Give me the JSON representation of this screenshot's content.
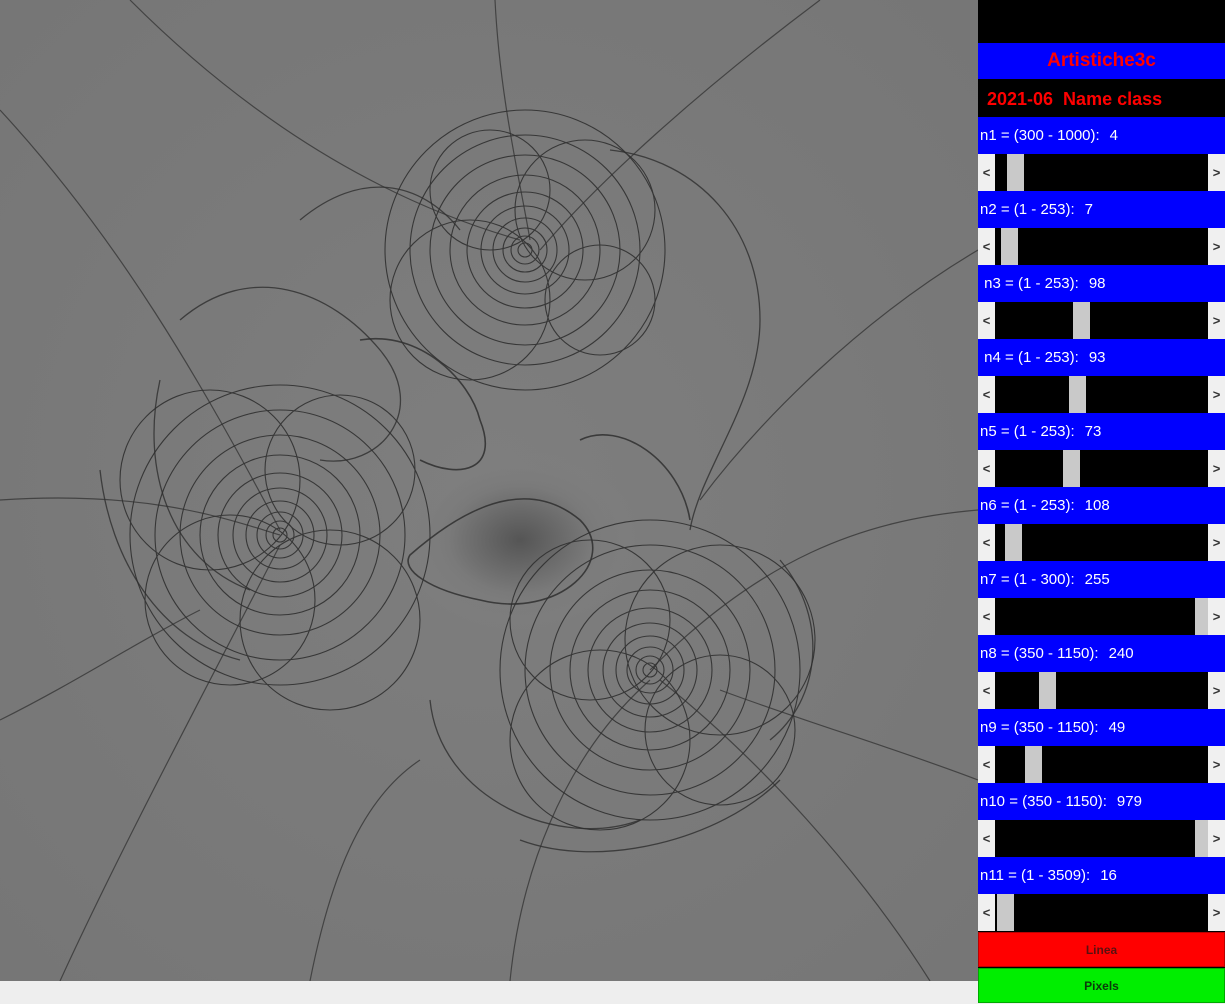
{
  "app": {
    "title": "Artistiche3c",
    "subtitle": "2021-06  Name class"
  },
  "params": [
    {
      "label": "n1 = (300 - 1000):",
      "value": "4",
      "slider_fraction": 0.06
    },
    {
      "label": "n2 = (1 - 253):",
      "value": "7",
      "slider_fraction": 0.03
    },
    {
      "label": " n3 = (1 - 253):",
      "value": "98",
      "slider_fraction": 0.39
    },
    {
      "label": " n4 = (1 - 253):",
      "value": "93",
      "slider_fraction": 0.37
    },
    {
      "label": "n5 = (1 - 253):",
      "value": "73",
      "slider_fraction": 0.34
    },
    {
      "label": "n6 = (1 - 253):",
      "value": "108",
      "slider_fraction": 0.05
    },
    {
      "label": "n7 = (1 - 300):",
      "value": "255",
      "slider_fraction": 1.0
    },
    {
      "label": "n8 = (350 - 1150):",
      "value": "240",
      "slider_fraction": 0.22
    },
    {
      "label": "n9 = (350 - 1150):",
      "value": "49",
      "slider_fraction": 0.15
    },
    {
      "label": "n10 = (350 - 1150):",
      "value": "979",
      "slider_fraction": 1.0
    },
    {
      "label": "n11 = (1 - 3509):",
      "value": "16",
      "slider_fraction": 0.01
    }
  ],
  "arrows": {
    "left": "<",
    "right": ">"
  },
  "buttons": {
    "linea": "Linea",
    "pixels": "Pixels"
  },
  "colors": {
    "panel_blue": "#0000ff",
    "title_red": "#ff0000",
    "linea_red": "#ff0000",
    "pixels_green": "#00ee00",
    "canvas_gray": "#787878"
  }
}
